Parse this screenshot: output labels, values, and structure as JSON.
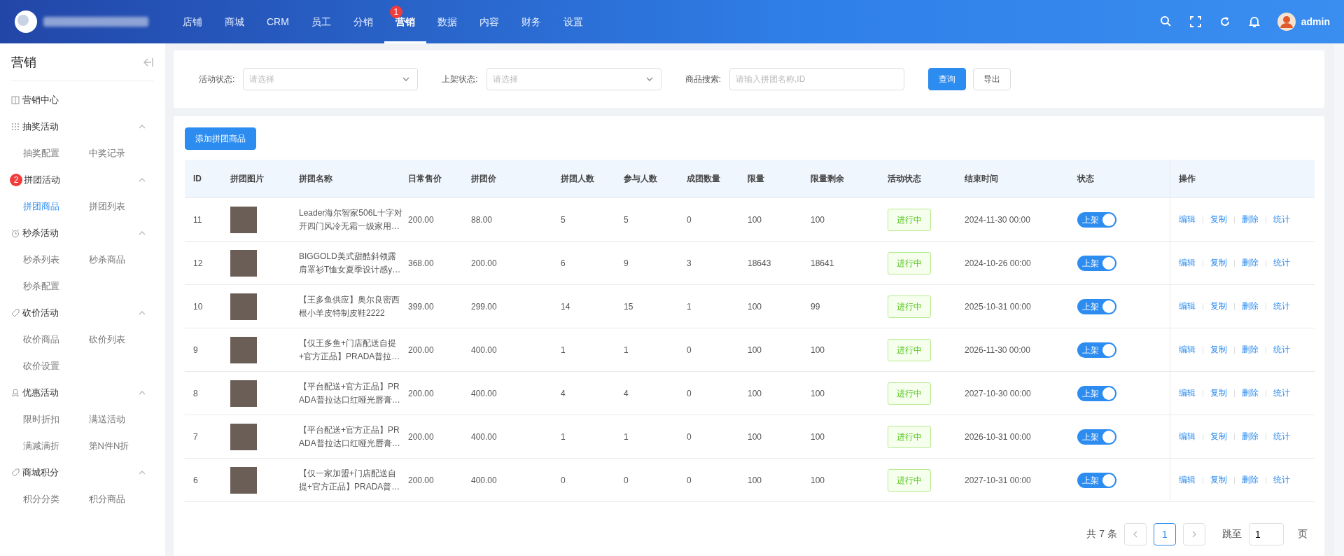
{
  "topbar": {
    "user": "admin",
    "nav": [
      {
        "label": "店铺",
        "selected": false
      },
      {
        "label": "商城",
        "selected": false
      },
      {
        "label": "CRM",
        "selected": false
      },
      {
        "label": "员工",
        "selected": false
      },
      {
        "label": "分销",
        "selected": false
      },
      {
        "label": "营销",
        "selected": true,
        "badge": "1"
      },
      {
        "label": "数据",
        "selected": false
      },
      {
        "label": "内容",
        "selected": false
      },
      {
        "label": "财务",
        "selected": false
      },
      {
        "label": "设置",
        "selected": false
      }
    ]
  },
  "sidebar": {
    "title": "营销",
    "groups": [
      {
        "label": "营销中心"
      },
      {
        "label": "抽奖活动",
        "expanded": true,
        "items": [
          {
            "label": "抽奖配置",
            "selected": false
          },
          {
            "label": "中奖记录",
            "selected": false
          }
        ]
      },
      {
        "label": "拼团活动",
        "expanded": true,
        "badge": "2",
        "items": [
          {
            "label": "拼团商品",
            "selected": true
          },
          {
            "label": "拼团列表",
            "selected": false
          }
        ]
      },
      {
        "label": "秒杀活动",
        "expanded": true,
        "items": [
          {
            "label": "秒杀列表",
            "selected": false
          },
          {
            "label": "秒杀商品",
            "selected": false
          },
          {
            "label": "秒杀配置",
            "selected": false
          }
        ]
      },
      {
        "label": "砍价活动",
        "expanded": true,
        "items": [
          {
            "label": "砍价商品",
            "selected": false
          },
          {
            "label": "砍价列表",
            "selected": false
          },
          {
            "label": "砍价设置",
            "selected": false
          }
        ]
      },
      {
        "label": "优惠活动",
        "expanded": true,
        "items": [
          {
            "label": "限时折扣",
            "selected": false
          },
          {
            "label": "满送活动",
            "selected": false
          },
          {
            "label": "满减满折",
            "selected": false
          },
          {
            "label": "第N件N折",
            "selected": false
          }
        ]
      },
      {
        "label": "商城积分",
        "expanded": true,
        "items": [
          {
            "label": "积分分类",
            "selected": false
          },
          {
            "label": "积分商品",
            "selected": false
          }
        ]
      }
    ]
  },
  "filters": [
    {
      "kind": "select",
      "label": "活动状态:",
      "placeholder": "请选择"
    },
    {
      "kind": "select",
      "label": "上架状态:",
      "placeholder": "请选择"
    },
    {
      "kind": "input",
      "label": "商品搜索:",
      "placeholder": "请输入拼团名称,ID"
    }
  ],
  "filter_buttons": [
    {
      "label": "查询",
      "kind": "primary"
    },
    {
      "label": "导出",
      "kind": "default"
    }
  ],
  "add_button": "添加拼团商品",
  "table": {
    "columns": [
      "ID",
      "拼团图片",
      "拼团名称",
      "日常售价",
      "拼团价",
      "拼团人数",
      "参与人数",
      "成团数量",
      "限量",
      "限量剩余",
      "活动状态",
      "结束时间",
      "状态",
      "操作"
    ],
    "rows": [
      {
        "id": "11",
        "name": "Leader海尔智家506L十字对开四门风冷无霜一级家用…",
        "price": "200.00",
        "group_price": "88.00",
        "group_size": "5",
        "participants": "5",
        "groups_formed": "0",
        "limit": "100",
        "remaining": "100",
        "activity_status": "进行中",
        "end_time": "2024-11-30 00:00",
        "listing": {
          "label": "上架",
          "on": true
        },
        "actions": [
          "编辑",
          "复制",
          "删除",
          "统计"
        ]
      },
      {
        "id": "12",
        "name": "BIGGOLD美式甜酷斜领露肩罩衫T恤女夏季设计感y…",
        "price": "368.00",
        "group_price": "200.00",
        "group_size": "6",
        "participants": "9",
        "groups_formed": "3",
        "limit": "18643",
        "remaining": "18641",
        "activity_status": "进行中",
        "end_time": "2024-10-26 00:00",
        "listing": {
          "label": "上架",
          "on": true
        },
        "actions": [
          "编辑",
          "复制",
          "删除",
          "统计"
        ]
      },
      {
        "id": "10",
        "name": "【王多鱼供应】奥尔良密西根小羊皮特制皮鞋2222",
        "price": "399.00",
        "group_price": "299.00",
        "group_size": "14",
        "participants": "15",
        "groups_formed": "1",
        "limit": "100",
        "remaining": "99",
        "activity_status": "进行中",
        "end_time": "2025-10-31 00:00",
        "listing": {
          "label": "上架",
          "on": true
        },
        "actions": [
          "编辑",
          "复制",
          "删除",
          "统计"
        ]
      },
      {
        "id": "9",
        "name": "【仅王多鱼+门店配送自提+官方正品】PRADA普拉…",
        "price": "200.00",
        "group_price": "400.00",
        "group_size": "1",
        "participants": "1",
        "groups_formed": "0",
        "limit": "100",
        "remaining": "100",
        "activity_status": "进行中",
        "end_time": "2026-11-30 00:00",
        "listing": {
          "label": "上架",
          "on": true
        },
        "actions": [
          "编辑",
          "复制",
          "删除",
          "统计"
        ]
      },
      {
        "id": "8",
        "name": "【平台配送+官方正品】PRADA普拉达口红哑光唇膏…",
        "price": "200.00",
        "group_price": "400.00",
        "group_size": "4",
        "participants": "4",
        "groups_formed": "0",
        "limit": "100",
        "remaining": "100",
        "activity_status": "进行中",
        "end_time": "2027-10-30 00:00",
        "listing": {
          "label": "上架",
          "on": true
        },
        "actions": [
          "编辑",
          "复制",
          "删除",
          "统计"
        ]
      },
      {
        "id": "7",
        "name": "【平台配送+官方正品】PRADA普拉达口红哑光唇膏…",
        "price": "200.00",
        "group_price": "400.00",
        "group_size": "1",
        "participants": "1",
        "groups_formed": "0",
        "limit": "100",
        "remaining": "100",
        "activity_status": "进行中",
        "end_time": "2026-10-31 00:00",
        "listing": {
          "label": "上架",
          "on": true
        },
        "actions": [
          "编辑",
          "复制",
          "删除",
          "统计"
        ]
      },
      {
        "id": "6",
        "name": "【仅一家加盟+门店配送自提+官方正品】PRADA普…",
        "price": "200.00",
        "group_price": "400.00",
        "group_size": "0",
        "participants": "0",
        "groups_formed": "0",
        "limit": "100",
        "remaining": "100",
        "activity_status": "进行中",
        "end_time": "2027-10-31 00:00",
        "listing": {
          "label": "上架",
          "on": true
        },
        "actions": [
          "编辑",
          "复制",
          "删除",
          "统计"
        ]
      }
    ]
  },
  "pagination": {
    "total": "共 7 条",
    "pages": [
      {
        "label": "1",
        "selected": true
      }
    ],
    "jump_label": "跳至",
    "jump_value": "1",
    "page_unit": "页"
  }
}
